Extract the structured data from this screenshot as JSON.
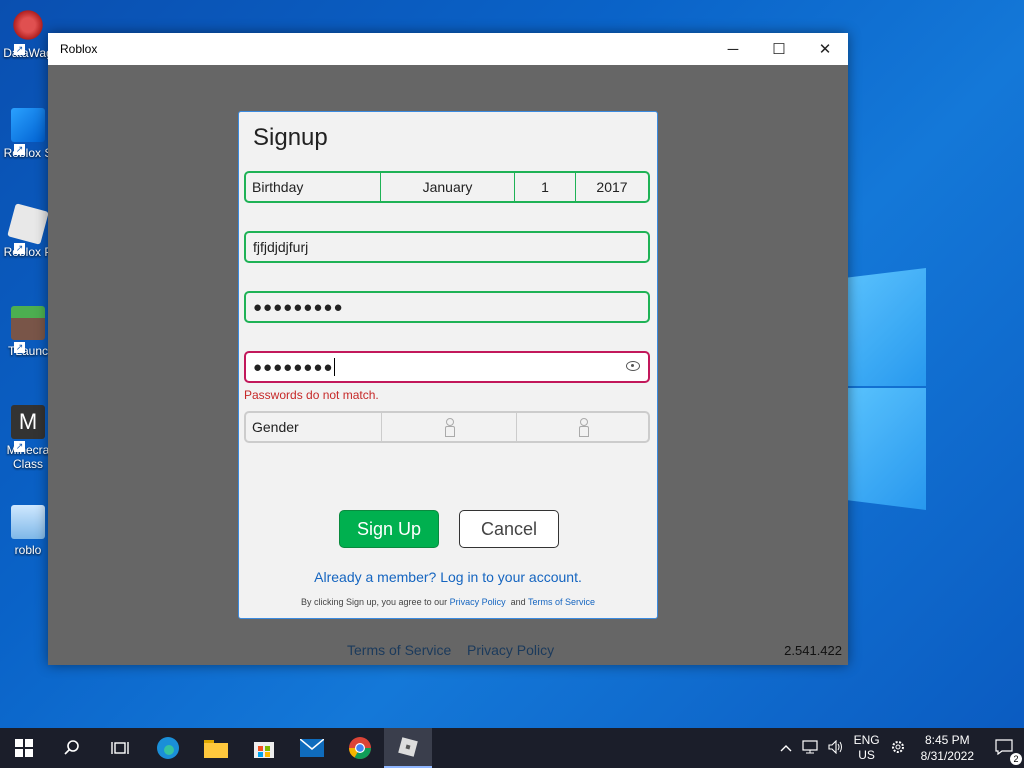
{
  "desktop": {
    "icons": [
      {
        "label": "DataWag"
      },
      {
        "label": "Roblox S"
      },
      {
        "label": "Roblox P"
      },
      {
        "label": "TLaunc"
      },
      {
        "label": "Minecra Class"
      },
      {
        "label": "roblo"
      }
    ]
  },
  "window": {
    "title": "Roblox",
    "controls": {
      "minimize": "─",
      "maximize": "☐",
      "close": "✕"
    },
    "footer_links": {
      "terms": "Terms of Service",
      "privacy": "Privacy Policy"
    },
    "version": "2.541.422"
  },
  "signup": {
    "heading": "Signup",
    "birthday": {
      "label": "Birthday",
      "month": "January",
      "day": "1",
      "year": "2017"
    },
    "username_value": "fjfjdjdjfurj",
    "password_value": "●●●●●●●●●",
    "confirm_password_value": "●●●●●●●●",
    "error": "Passwords do not match.",
    "gender": {
      "label": "Gender"
    },
    "signup_button": "Sign Up",
    "cancel_button": "Cancel",
    "member_link": "Already a member? Log in to your account.",
    "terms_prefix": "By clicking Sign up, you agree to our ",
    "privacy_link": "Privacy Policy",
    "terms_and": "  and ",
    "terms_link": "Terms of Service"
  },
  "taskbar": {
    "icons": [
      "windows-start-icon",
      "search-icon",
      "task-view-icon",
      "edge-icon",
      "file-explorer-icon",
      "store-icon",
      "mail-icon",
      "chrome-icon",
      "roblox-icon"
    ],
    "tray": {
      "language_top": "ENG",
      "language_bottom": "US",
      "time": "8:45 PM",
      "date": "8/31/2022",
      "notification_count": "2"
    }
  },
  "colors": {
    "accent_green": "#1fb256",
    "error": "#c62828",
    "link": "#1565c0",
    "signup_button": "#00b04f"
  }
}
